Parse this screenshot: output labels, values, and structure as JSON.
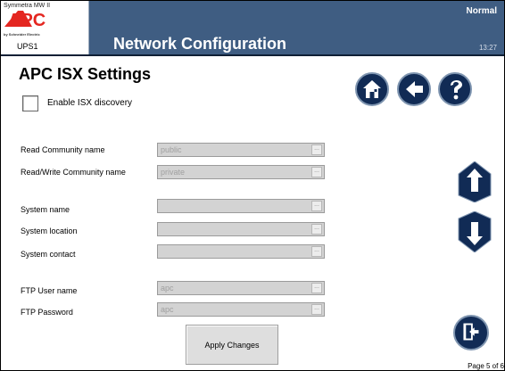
{
  "header": {
    "model": "Symmetra MW II",
    "brand": "APC",
    "parent_brand": "by Schneider Electric",
    "device": "UPS1",
    "title": "Network Configuration",
    "status": "Normal",
    "time": "13:27"
  },
  "page_title": "APC ISX Settings",
  "isx_discovery": {
    "label": "Enable ISX discovery",
    "checked": false
  },
  "fields": [
    {
      "label": "Read Community name",
      "value": "public"
    },
    {
      "label": "Read/Write Community name",
      "value": "private"
    },
    {
      "label": "System name",
      "value": ""
    },
    {
      "label": "System location",
      "value": ""
    },
    {
      "label": "System contact",
      "value": ""
    },
    {
      "label": "FTP User name",
      "value": "apc"
    },
    {
      "label": "FTP Password",
      "value": "apc"
    }
  ],
  "ellipsis": "...",
  "apply_label": "Apply Changes",
  "page_indicator": "Page 5 of 6",
  "icons": {
    "home": "home-icon",
    "back": "back-arrow-icon",
    "help": "help-icon",
    "up": "up-arrow-icon",
    "down": "down-arrow-icon",
    "exit": "exit-icon"
  },
  "colors": {
    "header": "#3f5d82",
    "button_dark": "#112b55",
    "field_fill": "#d3d3d3",
    "field_text": "#a0a0a0"
  }
}
